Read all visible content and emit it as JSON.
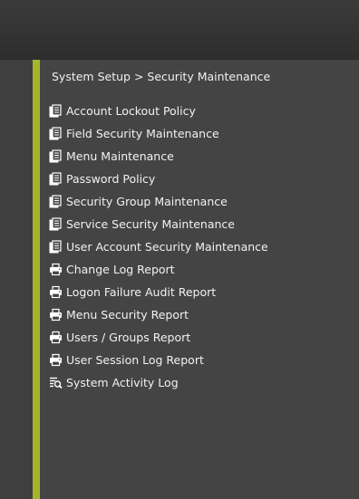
{
  "breadcrumb": "System Setup > Security Maintenance",
  "colors": {
    "accent": "#a5b52a",
    "background": "#444444",
    "header": "#333333",
    "text": "#f2f2f2"
  },
  "menu": {
    "items": [
      {
        "label": "Account Lockout Policy",
        "icon": "document-icon"
      },
      {
        "label": "Field Security Maintenance",
        "icon": "document-icon"
      },
      {
        "label": "Menu Maintenance",
        "icon": "document-icon"
      },
      {
        "label": "Password Policy",
        "icon": "document-icon"
      },
      {
        "label": "Security Group Maintenance",
        "icon": "document-icon"
      },
      {
        "label": "Service Security Maintenance",
        "icon": "document-icon"
      },
      {
        "label": "User Account Security Maintenance",
        "icon": "document-icon"
      },
      {
        "label": "Change Log Report",
        "icon": "printer-icon"
      },
      {
        "label": "Logon Failure Audit Report",
        "icon": "printer-icon"
      },
      {
        "label": "Menu Security Report",
        "icon": "printer-icon"
      },
      {
        "label": "Users / Groups Report",
        "icon": "printer-icon"
      },
      {
        "label": "User Session Log Report",
        "icon": "printer-icon"
      },
      {
        "label": "System Activity Log",
        "icon": "log-search-icon"
      }
    ]
  }
}
